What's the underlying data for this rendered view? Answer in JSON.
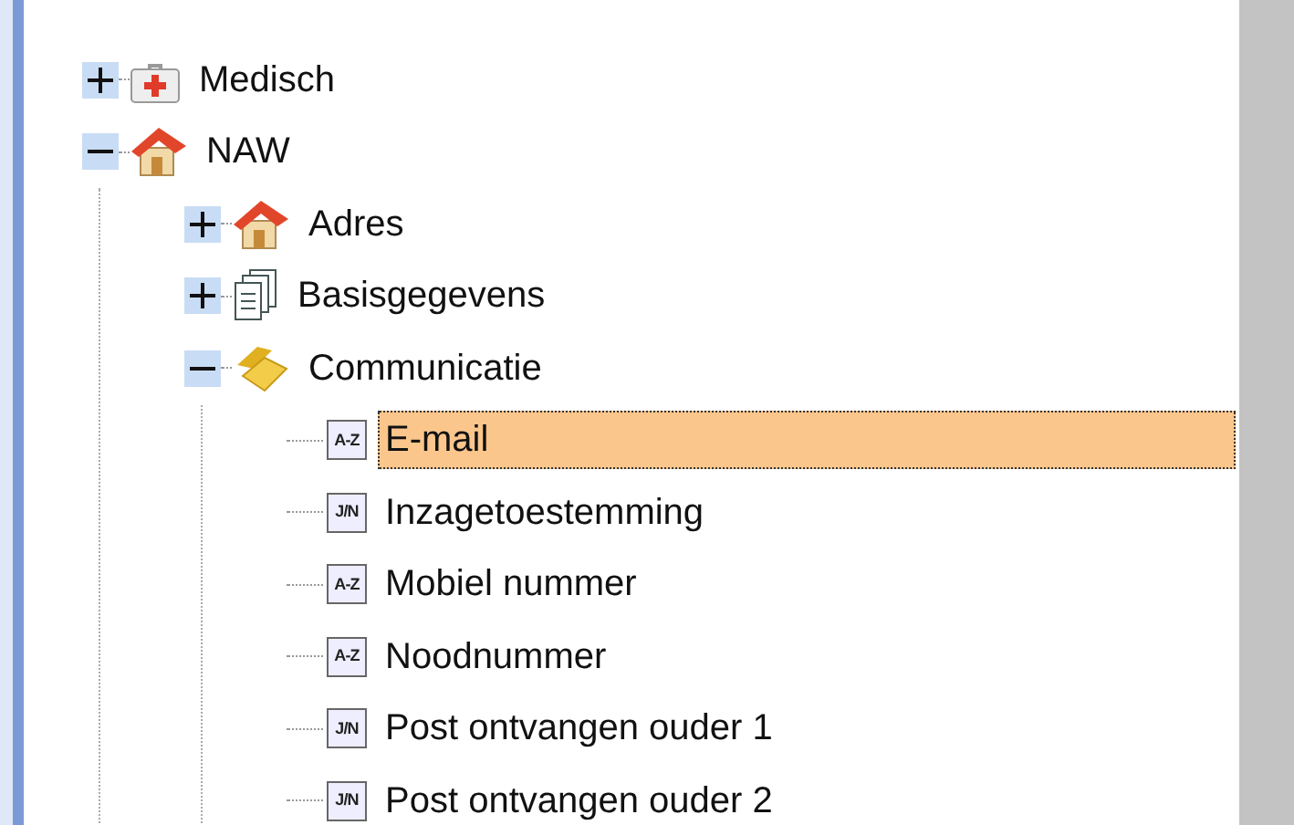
{
  "tree": [
    {
      "label": "Medisch",
      "kind": "medical",
      "expanded": false,
      "selected": false
    },
    {
      "label": "NAW",
      "kind": "house",
      "expanded": true,
      "selected": false,
      "children": [
        {
          "label": "Adres",
          "kind": "house",
          "expanded": false,
          "selected": false
        },
        {
          "label": "Basisgegevens",
          "kind": "documents",
          "expanded": false,
          "selected": false
        },
        {
          "label": "Communicatie",
          "kind": "phone",
          "expanded": true,
          "selected": false,
          "children": [
            {
              "label": "E-mail",
              "kind": "field",
              "type_label": "A-Z",
              "selected": true
            },
            {
              "label": "Inzagetoestemming",
              "kind": "field",
              "type_label": "J/N",
              "selected": false
            },
            {
              "label": "Mobiel nummer",
              "kind": "field",
              "type_label": "A-Z",
              "selected": false
            },
            {
              "label": "Noodnummer",
              "kind": "field",
              "type_label": "A-Z",
              "selected": false
            },
            {
              "label": "Post ontvangen ouder 1",
              "kind": "field",
              "type_label": "J/N",
              "selected": false
            },
            {
              "label": "Post ontvangen ouder 2",
              "kind": "field",
              "type_label": "J/N",
              "selected": false
            }
          ]
        }
      ]
    }
  ]
}
